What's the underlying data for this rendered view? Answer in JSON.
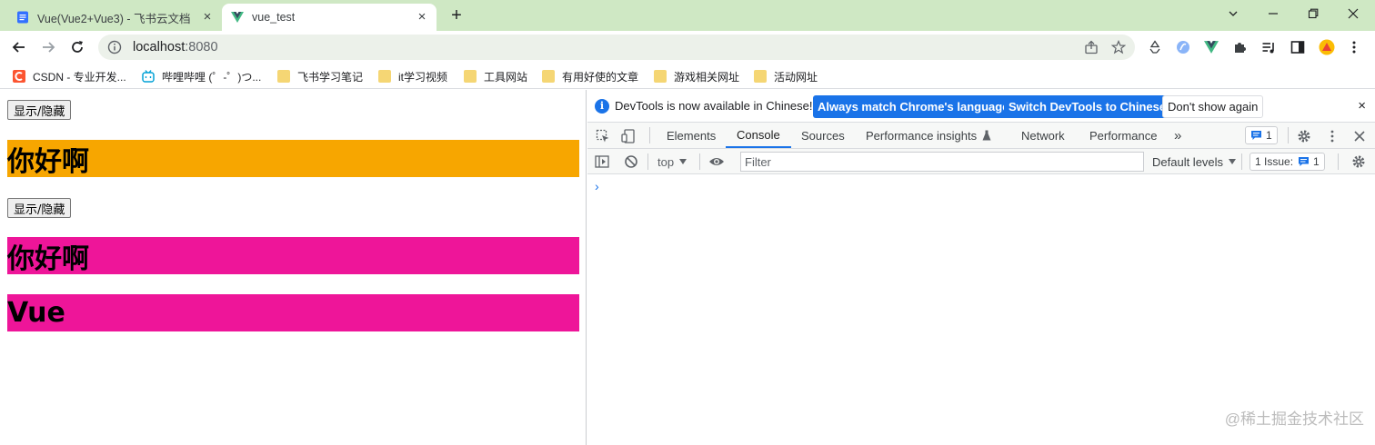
{
  "browser": {
    "tabs": [
      {
        "title": "Vue(Vue2+Vue3) - 飞书云文档",
        "close": "×",
        "icon": "doc-icon"
      },
      {
        "title": "vue_test",
        "close": "×",
        "icon": "vue-icon"
      }
    ],
    "new_tab": "+",
    "window_controls": [
      "chevron-down-icon",
      "minimize-icon",
      "restore-icon",
      "close-icon"
    ],
    "address": {
      "host": "localhost",
      "port": ":8080"
    },
    "bookmarks": [
      {
        "label": "CSDN - 专业开发...",
        "icon": "csdn-icon"
      },
      {
        "label": "哔哩哔哩 (゜-゜)つ...",
        "icon": "bilibili-icon"
      },
      {
        "label": "飞书学习笔记",
        "icon": "folder-icon"
      },
      {
        "label": "it学习视频",
        "icon": "folder-icon"
      },
      {
        "label": "工具网站",
        "icon": "folder-icon"
      },
      {
        "label": "有用好使的文章",
        "icon": "folder-icon"
      },
      {
        "label": "游戏相关网址",
        "icon": "folder-icon"
      },
      {
        "label": "活动网址",
        "icon": "folder-icon"
      }
    ]
  },
  "page": {
    "button1": "显示/隐藏",
    "heading1": "你好啊",
    "button2": "显示/隐藏",
    "heading2": "你好啊",
    "heading3": "Vue",
    "colors": {
      "orange": "#f7a600",
      "pink": "#ee1599"
    }
  },
  "devtools": {
    "infobar": {
      "message": "DevTools is now available in Chinese!",
      "btn_match": "Always match Chrome's language",
      "btn_switch": "Switch DevTools to Chinese",
      "btn_dont": "Don't show again",
      "close": "×"
    },
    "tabs": [
      "Elements",
      "Console",
      "Sources",
      "Performance insights",
      "Network",
      "Performance"
    ],
    "more_tabs": "»",
    "messages_badge": "1",
    "console": {
      "context": "top",
      "filter_placeholder": "Filter",
      "levels": "Default levels",
      "issues": "1 Issue:",
      "issues_count": "1",
      "prompt": "›"
    }
  },
  "watermark": "@稀土掘金技术社区"
}
